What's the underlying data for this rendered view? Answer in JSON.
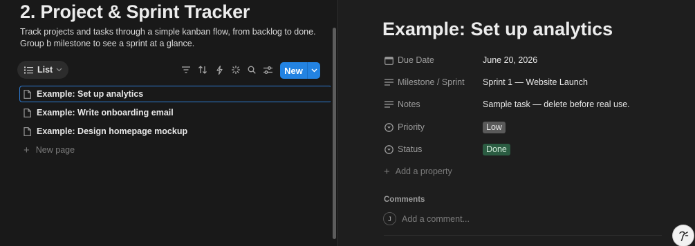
{
  "database": {
    "title": "2. Project & Sprint Tracker",
    "description": "Track projects and tasks through a simple kanban flow, from backlog to done. Group b milestone to see a sprint at a glance."
  },
  "toolbar": {
    "view_label": "List",
    "new_label": "New",
    "icons": [
      "filter-icon",
      "sort-icon",
      "automation-icon",
      "ai-sparkle-icon",
      "search-icon",
      "settings-sliders-icon"
    ]
  },
  "rows": [
    {
      "title": "Example: Set up analytics",
      "selected": true
    },
    {
      "title": "Example: Write onboarding email",
      "selected": false
    },
    {
      "title": "Example: Design homepage mockup",
      "selected": false
    }
  ],
  "new_page_label": "New page",
  "detail": {
    "title": "Example: Set up analytics",
    "properties": {
      "due": {
        "name": "Due Date",
        "value": "June 20, 2026",
        "icon": "calendar-icon"
      },
      "milestone": {
        "name": "Milestone / Sprint",
        "value": "Sprint 1 — Website Launch",
        "icon": "text-lines-icon"
      },
      "notes": {
        "name": "Notes",
        "value": "Sample task — delete before real use.",
        "icon": "text-lines-icon"
      },
      "priority": {
        "name": "Priority",
        "value": "Low",
        "icon": "select-circle-icon",
        "tag_bg": "#5a5a5a",
        "tag_fg": "#e6e6e6"
      },
      "status": {
        "name": "Status",
        "value": "Done",
        "icon": "select-circle-icon",
        "tag_bg": "#2b5c42",
        "tag_fg": "#d4ecdc"
      }
    },
    "add_property_label": "Add a property",
    "comments_heading": "Comments",
    "avatar_initial": "J",
    "comment_placeholder": "Add a comment..."
  },
  "colors": {
    "accent": "#2383e2",
    "background": "#191919",
    "panel": "#1e1e1e"
  }
}
